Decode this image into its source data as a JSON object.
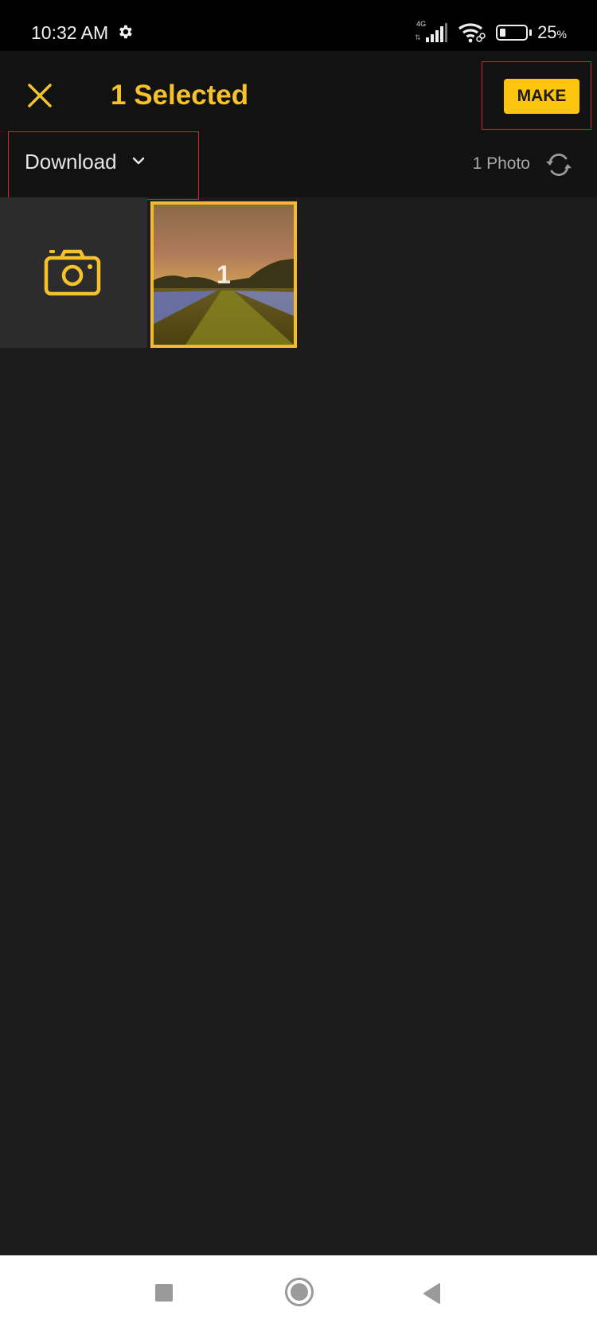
{
  "status_bar": {
    "time": "10:32 AM",
    "network_label": "4G",
    "battery_percent": "25",
    "battery_percent_sign": "%",
    "battery_level": 0.25,
    "icons": [
      "gear-icon",
      "signal-icon",
      "wifi-icon",
      "battery-icon"
    ]
  },
  "header": {
    "close_icon": "close-icon",
    "title": "1 Selected",
    "make_label": "MAKE",
    "accent_color": "#f5c22c",
    "button_color": "#fdc40f"
  },
  "toolbar": {
    "folder_label": "Download",
    "folder_icon": "chevron-down-icon",
    "photo_count": "1 Photo",
    "refresh_icon": "refresh-icon"
  },
  "grid": {
    "camera_tile_icon": "camera-icon",
    "photos": [
      {
        "selected": true,
        "selection_number": "1",
        "description": "landscape field at sunset"
      }
    ]
  },
  "nav_bar": {
    "icons": [
      "recent-apps-icon",
      "home-icon",
      "back-icon"
    ]
  }
}
